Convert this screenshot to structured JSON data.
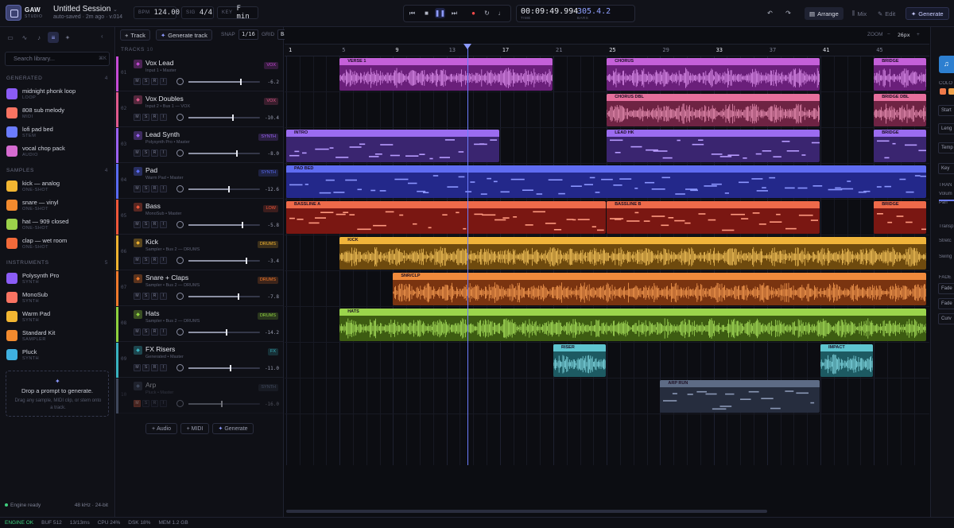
{
  "app": {
    "brand": "GAW",
    "brand_sub": "STUDIO",
    "session_title": "Untitled Session",
    "session_sub": "auto-saved · 2m ago · v.014"
  },
  "topbar": {
    "bpm_label": "BPM",
    "bpm": "124.00",
    "sig_label": "SIG",
    "sig": "4/4",
    "key_label": "KEY",
    "key": "F min",
    "time": "00:09:49.994",
    "time_label": "TIME",
    "bars": "305.4.2",
    "bars_label": "BARS",
    "views": [
      "Arrange",
      "Mix",
      "Edit"
    ],
    "generate": "Generate"
  },
  "library": {
    "search_placeholder": "Search library...",
    "search_kbd": "⌘K",
    "sections": [
      {
        "title": "GENERATED",
        "count": "4",
        "items": [
          {
            "name": "midnight phonk loop",
            "type": "LOOP",
            "color": "#8b5cf6"
          },
          {
            "name": "808 sub melody",
            "type": "MIDI",
            "color": "#f97362"
          },
          {
            "name": "lofi pad bed",
            "type": "STEM",
            "color": "#6b7cff"
          },
          {
            "name": "vocal chop pack",
            "type": "AUDIO",
            "color": "#d56bd0"
          }
        ]
      },
      {
        "title": "SAMPLES",
        "count": "4",
        "items": [
          {
            "name": "kick — analog",
            "type": "ONE-SHOT",
            "color": "#f2b632"
          },
          {
            "name": "snare — vinyl",
            "type": "ONE-SHOT",
            "color": "#f28a2e"
          },
          {
            "name": "hat — 909 closed",
            "type": "ONE-SHOT",
            "color": "#9bd14a"
          },
          {
            "name": "clap — wet room",
            "type": "ONE-SHOT",
            "color": "#f26a3a"
          }
        ]
      },
      {
        "title": "INSTRUMENTS",
        "count": "5",
        "items": [
          {
            "name": "Polysynth Pro",
            "type": "SYNTH",
            "color": "#8b5cf6"
          },
          {
            "name": "MonoSub",
            "type": "SYNTH",
            "color": "#f97362"
          },
          {
            "name": "Warm Pad",
            "type": "SYNTH",
            "color": "#f2b632"
          },
          {
            "name": "Standard Kit",
            "type": "SAMPLER",
            "color": "#f28a2e"
          },
          {
            "name": "Pluck",
            "type": "SYNTH",
            "color": "#3fb0e0"
          }
        ]
      }
    ],
    "drop_title": "Drop a prompt to generate.",
    "drop_sub": "Drag any sample, MIDI clip, or stem onto a track.",
    "engine": "Engine ready",
    "engine_spec": "48 kHz · 24-bit"
  },
  "toolbar": {
    "add_track": "Track",
    "generate_track": "Generate track",
    "snap_label": "SNAP",
    "snap": "1/16",
    "grid_label": "GRID",
    "grid": "Bar",
    "zoom_label": "ZOOM",
    "zoom": "26px"
  },
  "tracks_header": {
    "label": "TRACKS",
    "count": "10"
  },
  "tracks": [
    {
      "num": "01",
      "name": "Vox Lead",
      "route": "Input 1 • Master",
      "tag": "VOX",
      "db": "-6.2",
      "color": "#c64bd6",
      "level": 0.72
    },
    {
      "num": "02",
      "name": "Vox Doubles",
      "route": "Input 2 • Bus 1 — VOX",
      "tag": "VOX",
      "db": "-10.4",
      "color": "#e15a8e",
      "level": 0.61
    },
    {
      "num": "03",
      "name": "Lead Synth",
      "route": "Polysynth Pro • Master",
      "tag": "SYNTH",
      "db": "-8.0",
      "color": "#9b62f5",
      "level": 0.67
    },
    {
      "num": "04",
      "name": "Pad",
      "route": "Warm Pad • Master",
      "tag": "SYNTH",
      "db": "-12.6",
      "color": "#5a6cf5",
      "level": 0.55
    },
    {
      "num": "05",
      "name": "Bass",
      "route": "MonoSub • Master",
      "tag": "LOW",
      "db": "-5.8",
      "color": "#f0573a",
      "level": 0.74
    },
    {
      "num": "06",
      "name": "Kick",
      "route": "Sampler • Bus 2 — DRUMS",
      "tag": "DRUMS",
      "db": "-3.4",
      "color": "#f0b330",
      "level": 0.8
    },
    {
      "num": "07",
      "name": "Snare + Claps",
      "route": "Sampler • Bus 2 — DRUMS",
      "tag": "DRUMS",
      "db": "-7.8",
      "color": "#f07a2c",
      "level": 0.69
    },
    {
      "num": "08",
      "name": "Hats",
      "route": "Sampler • Bus 2 — DRUMS",
      "tag": "DRUMS",
      "db": "-14.2",
      "color": "#8fd23f",
      "level": 0.52
    },
    {
      "num": "09",
      "name": "FX Risers",
      "route": "Generated • Master",
      "tag": "FX",
      "db": "-11.0",
      "color": "#39b3c0",
      "level": 0.58
    },
    {
      "num": "10",
      "name": "Arp",
      "route": "Pluck • Master",
      "tag": "SYNTH",
      "db": "-16.0",
      "color": "#7b8bb0",
      "level": 0.45
    }
  ],
  "add_buttons": [
    "Audio",
    "MIDI",
    "Generate"
  ],
  "ruler": [
    "1",
    "5",
    "9",
    "13",
    "17",
    "21",
    "25",
    "29",
    "33",
    "37",
    "41",
    "45"
  ],
  "clips": [
    {
      "lane": 0,
      "label": "VERSE 1",
      "start": 5,
      "end": 21,
      "kind": "audio",
      "bg": "#6a1f7a",
      "hdr": "#c460d9",
      "wave": "#d98be8"
    },
    {
      "lane": 0,
      "label": "CHORUS",
      "start": 25,
      "end": 41,
      "kind": "audio",
      "bg": "#6a1f7a",
      "hdr": "#c460d9",
      "wave": "#d98be8"
    },
    {
      "lane": 0,
      "label": "BRIDGE",
      "start": 45,
      "end": 49,
      "kind": "audio",
      "bg": "#6a1f7a",
      "hdr": "#c460d9",
      "wave": "#d98be8"
    },
    {
      "lane": 1,
      "label": "CHORUS DBL",
      "start": 25,
      "end": 41,
      "kind": "audio",
      "bg": "#6e2343",
      "hdr": "#e56f9c",
      "wave": "#e88fb3"
    },
    {
      "lane": 1,
      "label": "BRIDGE DBL",
      "start": 45,
      "end": 49,
      "kind": "audio",
      "bg": "#6e2343",
      "hdr": "#e56f9c",
      "wave": "#e88fb3"
    },
    {
      "lane": 2,
      "label": "INTRO",
      "start": 1,
      "end": 17,
      "kind": "midi",
      "bg": "#3a2570",
      "hdr": "#9b6cf0",
      "wave": "#b79bff"
    },
    {
      "lane": 2,
      "label": "LEAD HK",
      "start": 25,
      "end": 41,
      "kind": "midi",
      "bg": "#3a2570",
      "hdr": "#9b6cf0",
      "wave": "#b79bff"
    },
    {
      "lane": 2,
      "label": "BRIDGE",
      "start": 45,
      "end": 49,
      "kind": "midi",
      "bg": "#3a2570",
      "hdr": "#9b6cf0",
      "wave": "#b79bff"
    },
    {
      "lane": 3,
      "label": "PAD BED",
      "start": 1,
      "end": 49,
      "kind": "midi",
      "bg": "#23288a",
      "hdr": "#5f6cf2",
      "wave": "#8b96ff"
    },
    {
      "lane": 4,
      "label": "BASSLINE A",
      "start": 1,
      "end": 25,
      "kind": "midi",
      "bg": "#7a1712",
      "hdr": "#ee6a4a",
      "wave": "#ff9a80"
    },
    {
      "lane": 4,
      "label": "BASSLINE B",
      "start": 25,
      "end": 41,
      "kind": "midi",
      "bg": "#7a1712",
      "hdr": "#ee6a4a",
      "wave": "#ff9a80"
    },
    {
      "lane": 4,
      "label": "BRIDGE",
      "start": 45,
      "end": 49,
      "kind": "midi",
      "bg": "#7a1712",
      "hdr": "#ee6a4a",
      "wave": "#ff9a80"
    },
    {
      "lane": 5,
      "label": "KICK",
      "start": 5,
      "end": 49,
      "kind": "audio",
      "bg": "#6e4a0e",
      "hdr": "#f0b43a",
      "wave": "#f5c45a"
    },
    {
      "lane": 6,
      "label": "SNR/CLP",
      "start": 9,
      "end": 49,
      "kind": "audio",
      "bg": "#7a3410",
      "hdr": "#f08a3c",
      "wave": "#f59a50"
    },
    {
      "lane": 7,
      "label": "HATS",
      "start": 5,
      "end": 49,
      "kind": "audio",
      "bg": "#3d5c12",
      "hdr": "#9bd54c",
      "wave": "#a6df5a"
    },
    {
      "lane": 8,
      "label": "RISER",
      "start": 21,
      "end": 25,
      "kind": "audio",
      "bg": "#1d5a62",
      "hdr": "#5ec4cf",
      "wave": "#7fd6e0"
    },
    {
      "lane": 8,
      "label": "IMPACT",
      "start": 41,
      "end": 45,
      "kind": "audio",
      "bg": "#1d5a62",
      "hdr": "#5ec4cf",
      "wave": "#7fd6e0"
    },
    {
      "lane": 9,
      "label": "ARP RUN",
      "start": 29,
      "end": 41,
      "kind": "midi",
      "bg": "#262d3e",
      "hdr": "#5d6b85",
      "wave": "#8a98b5"
    }
  ],
  "playhead_bar": 14.6,
  "inspector": {
    "labels": [
      "COLO",
      "Start",
      "Leng",
      "Temp",
      "Key",
      "TRAN",
      "Volum",
      "Pan",
      "Transp",
      "Stretc",
      "Swing",
      "FADE",
      "Fade",
      "Fade",
      "Curv"
    ]
  },
  "status": {
    "engine": "ENGINE OK",
    "buf": "BUF 512",
    "lat": "13/13ms",
    "cpu": "CPU 24%",
    "dsk": "DSK 18%",
    "mem": "MEM 1.2 GB"
  }
}
